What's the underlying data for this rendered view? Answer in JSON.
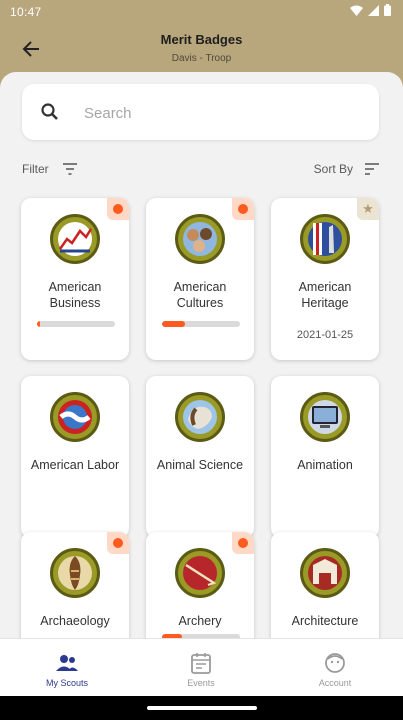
{
  "status": {
    "time": "10:47"
  },
  "header": {
    "title": "Merit Badges",
    "subtitle": "Davis - Troop"
  },
  "search": {
    "placeholder": "Search"
  },
  "toolbar": {
    "filter_label": "Filter",
    "sort_label": "Sort By"
  },
  "colors": {
    "header_bg": "#b8a67d",
    "accent": "#ff5a1f",
    "nav_active": "#2b3a8f"
  },
  "badges": [
    {
      "name": "American Business",
      "flag": "dot",
      "progress": 0.04,
      "date": ""
    },
    {
      "name": "American Cultures",
      "flag": "dot",
      "progress": 0.3,
      "date": ""
    },
    {
      "name": "American Heritage",
      "flag": "star",
      "progress": null,
      "date": "2021-01-25"
    },
    {
      "name": "American Labor",
      "flag": "",
      "progress": null,
      "date": ""
    },
    {
      "name": "Animal Science",
      "flag": "",
      "progress": null,
      "date": ""
    },
    {
      "name": "Animation",
      "flag": "",
      "progress": null,
      "date": ""
    },
    {
      "name": "Archaeology",
      "flag": "dot",
      "progress": null,
      "date": ""
    },
    {
      "name": "Archery",
      "flag": "dot",
      "progress": 0.25,
      "date": ""
    },
    {
      "name": "Architecture",
      "flag": "",
      "progress": null,
      "date": ""
    }
  ],
  "bottom_nav": [
    {
      "label": "My Scouts",
      "icon": "scouts-icon",
      "active": true
    },
    {
      "label": "Events",
      "icon": "calendar-icon",
      "active": false
    },
    {
      "label": "Account",
      "icon": "account-icon",
      "active": false
    }
  ]
}
